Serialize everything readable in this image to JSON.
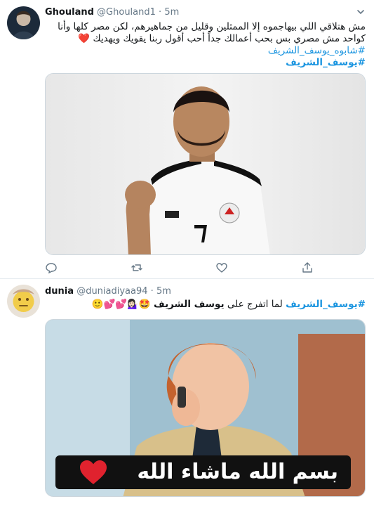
{
  "tweets": [
    {
      "author_name": "Ghouland",
      "author_handle": "@Ghouland1",
      "dot": "·",
      "time": "5m",
      "text_lines": [
        "مش هتلاقي اللي بيهاجموه إلا الممثلين وقليل من جماهيرهم، لكن مصر كلها وأنا",
        "كواحد مش مصري بس بحب أعمالك جداً أحب أقول ربنا يقويك ويهديك ❤️"
      ],
      "hashtags": [
        "#شابوه_يوسف_الشريف",
        "#يوسف_الشريف"
      ],
      "image_alt": "Man in white Egypt national football jersey smiling with fist raised"
    },
    {
      "author_name": "dunia",
      "author_handle": "@duniadiyaa94",
      "dot": "·",
      "time": "5m",
      "hashtag": "#يوسف_الشريف",
      "text_middle": " لما اتفرج على ",
      "text_bold": "يوسف الشريف",
      "text_emoji": " 🤩💁🏻‍♀️💕💕🙂",
      "image_caption": "بسم الله ماشاء الله"
    }
  ],
  "icons": [
    "chevron-down-icon",
    "reply-icon",
    "retweet-icon",
    "like-icon",
    "share-icon",
    "heart-icon"
  ],
  "colors": {
    "link": "#1b95e0",
    "muted": "#657786",
    "border": "#e6ecf0",
    "text": "#14171a"
  }
}
